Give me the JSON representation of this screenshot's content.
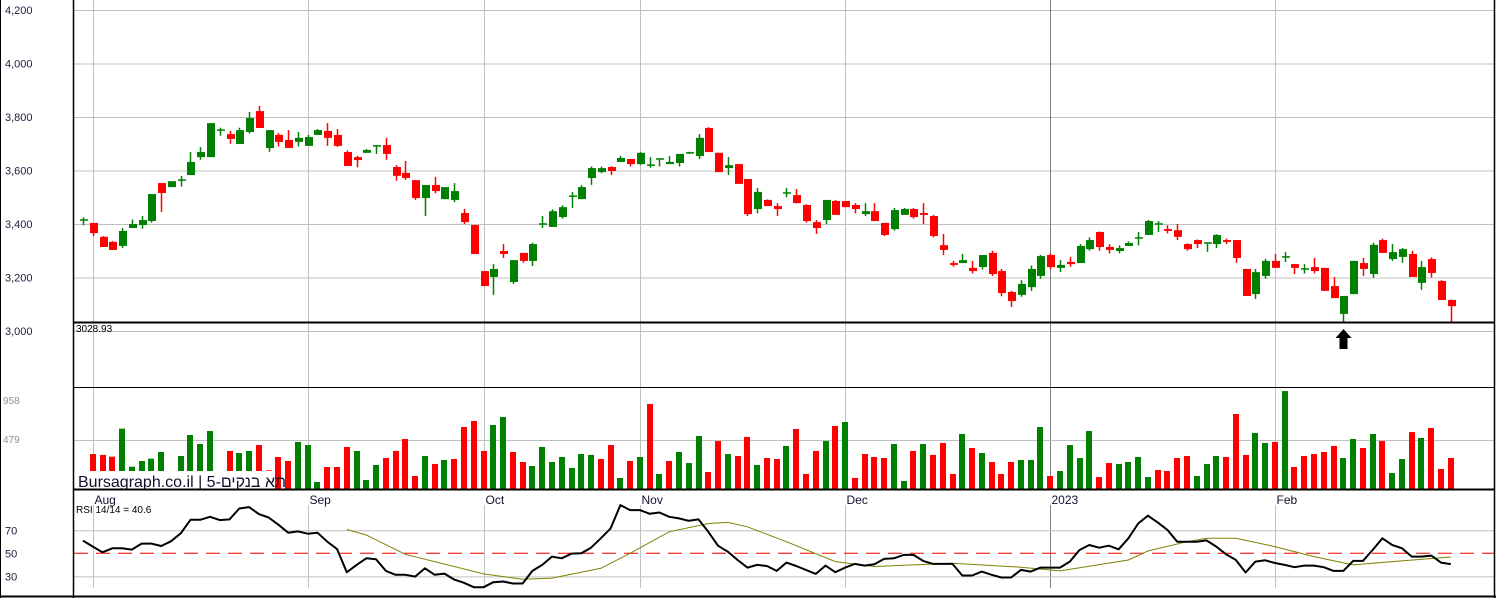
{
  "chart_data": [
    {
      "type": "candlestick",
      "title": "",
      "ylim": [
        3000,
        4200
      ],
      "yticks": [
        "3,000",
        "3,200",
        "3,400",
        "3,600",
        "3,800",
        "4,000",
        "4,200"
      ],
      "ytick_values": [
        3000,
        3200,
        3400,
        3600,
        3800,
        4000,
        4200
      ],
      "grid": true,
      "support_line": {
        "value": 3028.93,
        "label": "3028.93"
      },
      "marker_arrow_index": 129,
      "colors": {
        "up": "#008000",
        "down": "#ff0000"
      },
      "ohlc": [
        [
          3415,
          3425,
          3395,
          3415
        ],
        [
          3404,
          3404,
          3355,
          3366
        ],
        [
          3352,
          3355,
          3314,
          3314
        ],
        [
          3333,
          3336,
          3303,
          3303
        ],
        [
          3318,
          3385,
          3310,
          3374
        ],
        [
          3385,
          3417,
          3385,
          3400
        ],
        [
          3396,
          3430,
          3382,
          3415
        ],
        [
          3411,
          3512,
          3405,
          3512
        ],
        [
          3553,
          3553,
          3445,
          3516
        ],
        [
          3538,
          3560,
          3538,
          3560
        ],
        [
          3564,
          3580,
          3540,
          3564
        ],
        [
          3583,
          3669,
          3583,
          3632
        ],
        [
          3650,
          3688,
          3640,
          3669
        ],
        [
          3650,
          3777,
          3650,
          3777
        ],
        [
          3751,
          3760,
          3730,
          3751
        ],
        [
          3736,
          3748,
          3700,
          3718
        ],
        [
          3699,
          3760,
          3699,
          3751
        ],
        [
          3744,
          3819,
          3738,
          3796
        ],
        [
          3822,
          3841,
          3759,
          3759
        ],
        [
          3684,
          3751,
          3670,
          3751
        ],
        [
          3733,
          3740,
          3690,
          3707
        ],
        [
          3714,
          3751,
          3684,
          3684
        ],
        [
          3707,
          3744,
          3690,
          3722
        ],
        [
          3692,
          3733,
          3692,
          3725
        ],
        [
          3733,
          3755,
          3733,
          3751
        ],
        [
          3748,
          3777,
          3692,
          3722
        ],
        [
          3733,
          3755,
          3688,
          3692
        ],
        [
          3669,
          3675,
          3617,
          3617
        ],
        [
          3650,
          3655,
          3612,
          3639
        ],
        [
          3666,
          3680,
          3666,
          3677
        ],
        [
          3692,
          3695,
          3662,
          3692
        ],
        [
          3695,
          3722,
          3640,
          3662
        ],
        [
          3613,
          3620,
          3562,
          3580
        ],
        [
          3591,
          3636,
          3565,
          3572
        ],
        [
          3564,
          3564,
          3490,
          3497
        ],
        [
          3497,
          3546,
          3430,
          3546
        ],
        [
          3546,
          3576,
          3515,
          3523
        ],
        [
          3493,
          3538,
          3493,
          3538
        ],
        [
          3490,
          3553,
          3482,
          3523
        ],
        [
          3441,
          3456,
          3400,
          3407
        ],
        [
          3396,
          3396,
          3288,
          3288
        ],
        [
          3224,
          3224,
          3168,
          3168
        ],
        [
          3202,
          3250,
          3135,
          3232
        ],
        [
          3299,
          3325,
          3273,
          3288
        ],
        [
          3183,
          3265,
          3176,
          3265
        ],
        [
          3292,
          3292,
          3255,
          3262
        ],
        [
          3262,
          3330,
          3243,
          3325
        ],
        [
          3400,
          3430,
          3385,
          3400
        ],
        [
          3389,
          3455,
          3389,
          3448
        ],
        [
          3426,
          3470,
          3420,
          3463
        ],
        [
          3504,
          3520,
          3460,
          3504
        ],
        [
          3493,
          3545,
          3493,
          3538
        ],
        [
          3572,
          3615,
          3546,
          3609
        ],
        [
          3594,
          3615,
          3590,
          3609
        ],
        [
          3613,
          3616,
          3583,
          3598
        ],
        [
          3632,
          3655,
          3632,
          3647
        ],
        [
          3643,
          3643,
          3615,
          3624
        ],
        [
          3624,
          3670,
          3620,
          3666
        ],
        [
          3620,
          3650,
          3610,
          3620
        ],
        [
          3643,
          3645,
          3615,
          3643
        ],
        [
          3624,
          3654,
          3624,
          3632
        ],
        [
          3628,
          3662,
          3615,
          3662
        ],
        [
          3662,
          3670,
          3662,
          3666
        ],
        [
          3654,
          3736,
          3643,
          3722
        ],
        [
          3759,
          3762,
          3669,
          3669
        ],
        [
          3666,
          3666,
          3594,
          3594
        ],
        [
          3609,
          3650,
          3583,
          3620
        ],
        [
          3624,
          3624,
          3550,
          3550
        ],
        [
          3568,
          3568,
          3430,
          3437
        ],
        [
          3456,
          3535,
          3440,
          3520
        ],
        [
          3490,
          3492,
          3467,
          3467
        ],
        [
          3467,
          3478,
          3430,
          3456
        ],
        [
          3516,
          3535,
          3500,
          3516
        ],
        [
          3508,
          3531,
          3478,
          3478
        ],
        [
          3471,
          3474,
          3405,
          3411
        ],
        [
          3407,
          3415,
          3363,
          3385
        ],
        [
          3415,
          3490,
          3400,
          3490
        ],
        [
          3486,
          3490,
          3434,
          3434
        ],
        [
          3486,
          3486,
          3463,
          3463
        ],
        [
          3471,
          3478,
          3440,
          3456
        ],
        [
          3437,
          3478,
          3430,
          3448
        ],
        [
          3448,
          3478,
          3411,
          3411
        ],
        [
          3404,
          3404,
          3355,
          3359
        ],
        [
          3381,
          3460,
          3375,
          3452
        ],
        [
          3434,
          3460,
          3434,
          3456
        ],
        [
          3456,
          3460,
          3420,
          3426
        ],
        [
          3441,
          3478,
          3400,
          3434
        ],
        [
          3430,
          3434,
          3350,
          3355
        ],
        [
          3321,
          3363,
          3284,
          3303
        ],
        [
          3254,
          3262,
          3240,
          3247
        ],
        [
          3254,
          3288,
          3254,
          3265
        ],
        [
          3236,
          3262,
          3215,
          3224
        ],
        [
          3239,
          3284,
          3230,
          3284
        ],
        [
          3292,
          3300,
          3205,
          3213
        ],
        [
          3224,
          3232,
          3130,
          3142
        ],
        [
          3146,
          3150,
          3090,
          3112
        ],
        [
          3135,
          3190,
          3128,
          3176
        ],
        [
          3164,
          3245,
          3150,
          3232
        ],
        [
          3206,
          3285,
          3195,
          3280
        ],
        [
          3284,
          3290,
          3230,
          3239
        ],
        [
          3236,
          3265,
          3220,
          3247
        ],
        [
          3258,
          3277,
          3240,
          3250
        ],
        [
          3254,
          3325,
          3254,
          3318
        ],
        [
          3306,
          3350,
          3300,
          3340
        ],
        [
          3370,
          3372,
          3300,
          3314
        ],
        [
          3314,
          3325,
          3290,
          3303
        ],
        [
          3299,
          3320,
          3290,
          3310
        ],
        [
          3318,
          3335,
          3318,
          3329
        ],
        [
          3348,
          3370,
          3320,
          3348
        ],
        [
          3359,
          3415,
          3359,
          3411
        ],
        [
          3400,
          3411,
          3370,
          3400
        ],
        [
          3381,
          3395,
          3365,
          3374
        ],
        [
          3377,
          3400,
          3340,
          3352
        ],
        [
          3325,
          3328,
          3300,
          3306
        ],
        [
          3340,
          3342,
          3310,
          3325
        ],
        [
          3329,
          3330,
          3296,
          3329
        ],
        [
          3325,
          3362,
          3310,
          3359
        ],
        [
          3340,
          3345,
          3325,
          3333
        ],
        [
          3340,
          3340,
          3255,
          3273
        ],
        [
          3232,
          3232,
          3131,
          3131
        ],
        [
          3138,
          3232,
          3120,
          3220
        ],
        [
          3206,
          3270,
          3195,
          3262
        ],
        [
          3262,
          3288,
          3236,
          3236
        ],
        [
          3277,
          3295,
          3258,
          3277
        ],
        [
          3250,
          3250,
          3213,
          3236
        ],
        [
          3232,
          3250,
          3215,
          3232
        ],
        [
          3239,
          3273,
          3215,
          3224
        ],
        [
          3236,
          3236,
          3150,
          3150
        ],
        [
          3168,
          3202,
          3123,
          3123
        ],
        [
          3064,
          3131,
          3030,
          3131
        ],
        [
          3138,
          3262,
          3138,
          3262
        ],
        [
          3254,
          3273,
          3206,
          3232
        ],
        [
          3213,
          3330,
          3200,
          3322
        ],
        [
          3340,
          3345,
          3292,
          3292
        ],
        [
          3269,
          3325,
          3262,
          3295
        ],
        [
          3277,
          3310,
          3255,
          3306
        ],
        [
          3288,
          3300,
          3202,
          3202
        ],
        [
          3180,
          3262,
          3154,
          3239
        ],
        [
          3269,
          3275,
          3200,
          3217
        ],
        [
          3187,
          3190,
          3116,
          3116
        ],
        [
          3116,
          3118,
          3034,
          3093
        ]
      ]
    },
    {
      "type": "bar",
      "name": "volume",
      "ylim": [
        0,
        997
      ],
      "yticks": [
        "958",
        "479"
      ],
      "ytick_values": [
        958,
        479
      ],
      "start_index": 1,
      "values": [
        342,
        333,
        316,
        590,
        218,
        274,
        297,
        362,
        110,
        323,
        528,
        440,
        567,
        120,
        372,
        352,
        372,
        430,
        183,
        313,
        274,
        460,
        430,
        68,
        215,
        215,
        411,
        372,
        88,
        235,
        303,
        372,
        489,
        127,
        323,
        245,
        284,
        293,
        606,
        665,
        372,
        626,
        704,
        362,
        264,
        225,
        411,
        264,
        313,
        205,
        342,
        333,
        293,
        430,
        108,
        274,
        313,
        831,
        147,
        274,
        362,
        254,
        518,
        166,
        469,
        342,
        323,
        509,
        235,
        303,
        293,
        421,
        587,
        147,
        372,
        469,
        616,
        655,
        108,
        342,
        313,
        303,
        440,
        78,
        372,
        440,
        333,
        450,
        147,
        538,
        401,
        352,
        264,
        147,
        264,
        284,
        284,
        606,
        127,
        176,
        430,
        303,
        567,
        117,
        254,
        245,
        264,
        313,
        117,
        186,
        176,
        303,
        323,
        127,
        245,
        323,
        313,
        734,
        333,
        548,
        450,
        460,
        958,
        215,
        323,
        342,
        362,
        421,
        303,
        489,
        401,
        538,
        469,
        156,
        293,
        557,
        499,
        597,
        196,
        303
      ],
      "colors_seq": "RRRGGGGGGGGGGGRGGRRRRGGGRRRGGGRRRRGRGRRRRGGRRGGG GGGGRRGRGRGRGGGRRGRRGRRGRRRGRGRRRRGGRGRRRGRGRRRG GGRGGGGRRGGGGRRRRGGGRRRGGRGRRRRRGGRGRGGRGRRR",
      "watermark": "Bursagraph.co.il | 5-תא בנקים"
    },
    {
      "type": "line",
      "name": "RSI",
      "label": "RSI 14/14 = 40.6",
      "ylim": [
        10,
        100
      ],
      "yticks": [
        "70",
        "50",
        "30"
      ],
      "ytick_values": [
        70,
        50,
        30
      ],
      "reference_line": 50,
      "rsi": [
        61,
        55.8,
        50.9,
        54.3,
        54.3,
        53.2,
        58.4,
        58.4,
        56.3,
        60.4,
        67.3,
        79.1,
        79.1,
        81.7,
        78.8,
        79.4,
        88.9,
        90.1,
        84,
        81.1,
        74.8,
        67.9,
        69,
        67,
        67.9,
        60.1,
        53.7,
        33.6,
        39.9,
        45.7,
        44.8,
        34.7,
        31.3,
        31.3,
        29.8,
        37,
        31.3,
        32.4,
        27.2,
        24.4,
        20.6,
        20.6,
        24.9,
        25.5,
        23.8,
        23.8,
        34.7,
        39.9,
        47.1,
        45.7,
        49.7,
        50,
        54.9,
        63,
        71.6,
        91.8,
        87.5,
        87.5,
        84.3,
        85.4,
        81.7,
        80.3,
        78.2,
        79.4,
        68.7,
        56.6,
        51.4,
        44.2,
        37.6,
        39.9,
        39,
        34.7,
        41.9,
        39,
        35.6,
        32.1,
        39.3,
        33.6,
        37.6,
        40.8,
        39.3,
        40.5,
        45.1,
        45.7,
        48.6,
        48.6,
        43.4,
        40.8,
        40.8,
        40.8,
        30.7,
        30.7,
        34.1,
        31.3,
        29,
        29,
        35.6,
        34.1,
        37.6,
        37.6,
        37.6,
        42.8,
        52.9,
        57.2,
        54.9,
        56.6,
        53.5,
        63,
        75.9,
        82.6,
        76.8,
        70.2,
        60.1,
        60.1,
        60.1,
        61.2,
        55.8,
        49.1,
        44.2,
        33.3,
        42.8,
        43.9,
        41.6,
        39.9,
        37.9,
        39.3,
        39.3,
        37.9,
        34.7,
        34.7,
        43.4,
        43.4,
        52.9,
        63,
        57.2,
        54.3,
        47.1,
        47.1,
        48,
        41.9,
        40.6
      ],
      "signal": [
        [
          27,
          70.7
        ],
        [
          29,
          65.9
        ],
        [
          33,
          49.1
        ],
        [
          41,
          32.1
        ],
        [
          45,
          27.5
        ],
        [
          48,
          28.5
        ],
        [
          53,
          37
        ],
        [
          56,
          50
        ],
        [
          60,
          68.7
        ],
        [
          64,
          75.9
        ],
        [
          66,
          76.8
        ],
        [
          68,
          73
        ],
        [
          72,
          60.1
        ],
        [
          77,
          42.8
        ],
        [
          81,
          38.5
        ],
        [
          89,
          41.4
        ],
        [
          96,
          37.9
        ],
        [
          100,
          34.7
        ],
        [
          107,
          44.2
        ],
        [
          109,
          52
        ],
        [
          113,
          60.1
        ],
        [
          115,
          63
        ],
        [
          118,
          63
        ],
        [
          122,
          55.8
        ],
        [
          126,
          47.1
        ],
        [
          130,
          39.9
        ],
        [
          132,
          41.4
        ],
        [
          140,
          46.8
        ]
      ],
      "colors": {
        "rsi": "#000000",
        "signal": "#808000",
        "reference": "#ff0000"
      }
    }
  ],
  "x_axis": {
    "months": [
      {
        "label": "Aug",
        "index": 1
      },
      {
        "label": "Sep",
        "index": 23
      },
      {
        "label": "Oct",
        "index": 41
      },
      {
        "label": "Nov",
        "index": 57
      },
      {
        "label": "Dec",
        "index": 78
      },
      {
        "label": "2023",
        "index": 99
      },
      {
        "label": "Feb",
        "index": 122
      }
    ]
  }
}
